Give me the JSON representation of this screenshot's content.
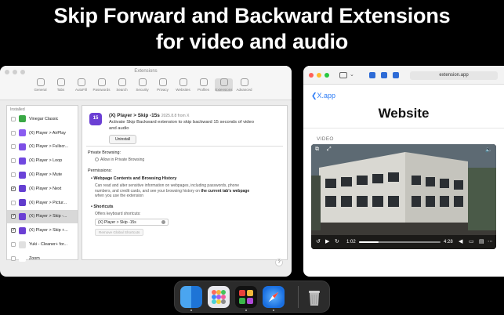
{
  "headline": {
    "line1": "Skip Forward and Backward Extensions",
    "line2": "for video and audio"
  },
  "extensions_window": {
    "title": "Extensions",
    "toolbar": [
      {
        "label": "General",
        "icon": "gear-icon"
      },
      {
        "label": "Tabs",
        "icon": "tabs-icon"
      },
      {
        "label": "AutoFill",
        "icon": "autofill-icon"
      },
      {
        "label": "Passwords",
        "icon": "key-icon"
      },
      {
        "label": "Search",
        "icon": "search-icon"
      },
      {
        "label": "Security",
        "icon": "lock-icon"
      },
      {
        "label": "Privacy",
        "icon": "hand-icon"
      },
      {
        "label": "Websites",
        "icon": "globe-icon"
      },
      {
        "label": "Profiles",
        "icon": "person-icon"
      },
      {
        "label": "Extensions",
        "icon": "puzzle-icon"
      },
      {
        "label": "Advanced",
        "icon": "gears-icon"
      }
    ],
    "list_header": "Installed",
    "list": [
      {
        "label": "Vinegar Classic",
        "checked": false,
        "color": "#3aa845"
      },
      {
        "label": "(X) Player > AirPlay",
        "checked": false,
        "color": "#8a5cf0"
      },
      {
        "label": "(X) Player > Fullscr...",
        "checked": false,
        "color": "#7d4fe6"
      },
      {
        "label": "(X) Player > Loop",
        "checked": false,
        "color": "#7048e0"
      },
      {
        "label": "(X) Player > Mute",
        "checked": false,
        "color": "#6a42d8"
      },
      {
        "label": "(X) Player > Next",
        "checked": true,
        "color": "#6540d2"
      },
      {
        "label": "(X) Player > Pictur...",
        "checked": false,
        "color": "#603ccc"
      },
      {
        "label": "(X) Player > Skip -...",
        "checked": true,
        "color": "#6b3fd4",
        "selected": true
      },
      {
        "label": "(X) Player > Skip +...",
        "checked": true,
        "color": "#6b3fd4"
      },
      {
        "label": "Yuki - Cleaner+ for...",
        "checked": false,
        "color": "#e0e0e0"
      },
      {
        "label": "Zoom",
        "checked": false,
        "color": "#ffffff"
      }
    ],
    "detail": {
      "name": "(X) Player > Skip -15s",
      "version": "2025.8.8 from X",
      "description": "Activate Skip Backward extension to skip backward 15 seconds of video and audio",
      "uninstall": "Uninstall",
      "private_browsing_label": "Private Browsing:",
      "allow_private": "Allow in Private Browsing",
      "permissions_label": "Permissions:",
      "perm_title": "Webpage Contents and Browsing History",
      "perm_text_1": "Can read and alter sensitive information on webpages, including passwords, phone",
      "perm_text_2": "numbers, and credit cards, and see your browsing history on",
      "perm_text_bold": "the current tab's webpage",
      "perm_text_3": "when you use the extension",
      "shortcuts_title": "Shortcuts",
      "shortcuts_text": "Offers keyboard shortcuts:",
      "shortcut_value": "(X) Player > Skip -15s",
      "remove_shortcuts": "Remove Global Shortcuts",
      "help": "?"
    }
  },
  "browser_window": {
    "url": "extension.app",
    "back_label": "X.app",
    "page_title": "Website",
    "video_label": "VIDEO",
    "time_elapsed": "1:02",
    "time_total": "4:28",
    "progress": 0.24
  },
  "dock": {
    "apps": [
      "Finder",
      "Launchpad",
      "X Player",
      "Safari",
      "Trash"
    ]
  }
}
